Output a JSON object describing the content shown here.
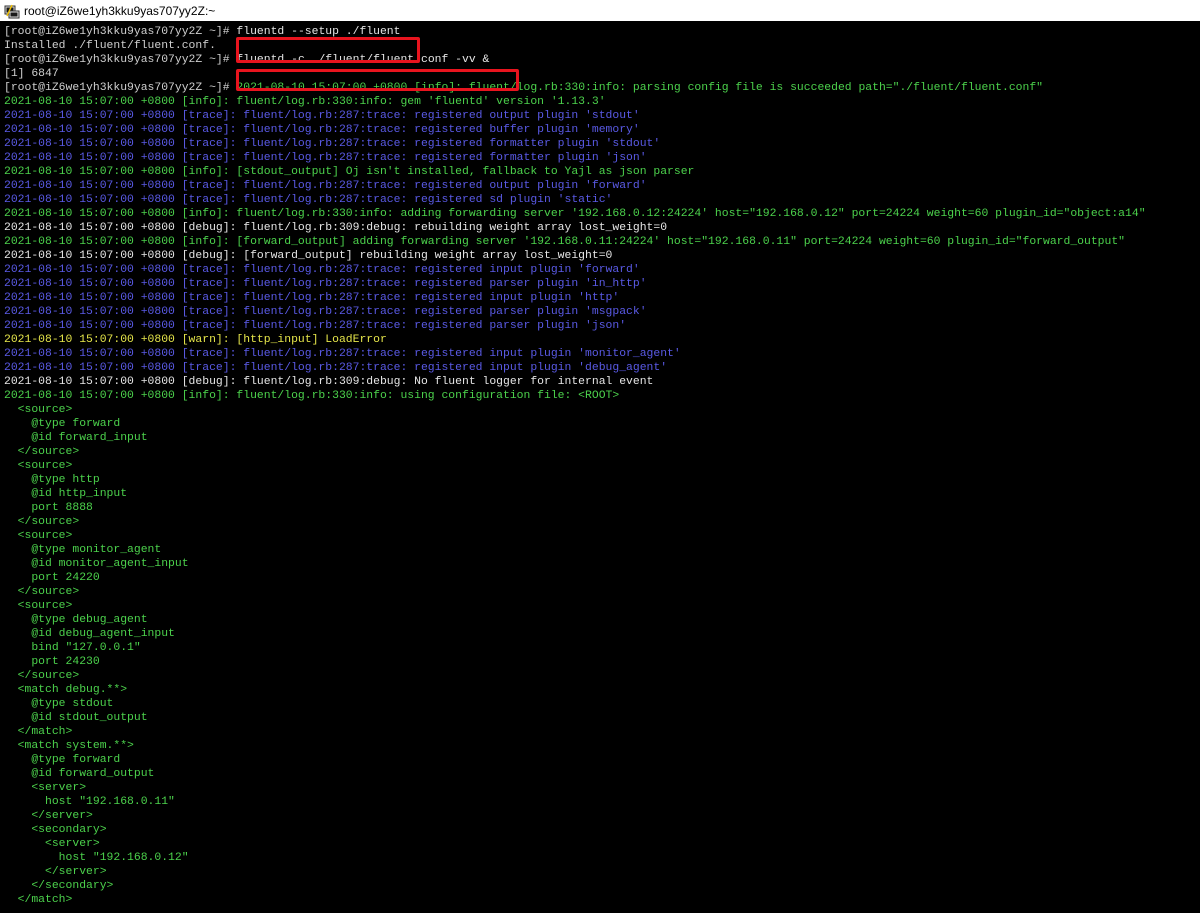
{
  "window": {
    "title": "root@iZ6we1yh3kku9yas707yy2Z:~",
    "icon": "putty-terminal-icon"
  },
  "colors": {
    "info": "#4cd24c",
    "trace": "#5a5ae6",
    "debug": "#e6e6e6",
    "warn": "#e6e64a",
    "plain": "#d0d0d0",
    "highlight_box": "#e8141e"
  },
  "terminal": {
    "lines": [
      {
        "segments": [
          {
            "t": "[root@iZ6we1yh3kku9yas707yy2Z ~]# ",
            "c": "plain"
          },
          {
            "t": "fluentd --setup ./fluent",
            "c": "cmd"
          }
        ],
        "highlight": true
      },
      {
        "segments": [
          {
            "t": "Installed ./fluent/fluent.conf.",
            "c": "plain"
          }
        ]
      },
      {
        "segments": [
          {
            "t": "[root@iZ6we1yh3kku9yas707yy2Z ~]# ",
            "c": "plain"
          },
          {
            "t": "fluentd -c ./fluent/fluent.conf -vv &",
            "c": "cmd"
          }
        ],
        "highlight": true
      },
      {
        "segments": [
          {
            "t": "[1] 6847",
            "c": "plain"
          }
        ]
      },
      {
        "segments": [
          {
            "t": "[root@iZ6we1yh3kku9yas707yy2Z ~]# ",
            "c": "plain"
          },
          {
            "t": "2021-08-10 15:07:00 +0800 [info]: fluent/log.rb:330:info: parsing config file is succeeded path=\"./fluent/fluent.conf\"",
            "c": "green"
          }
        ]
      },
      {
        "segments": [
          {
            "t": "2021-08-10 15:07:00 +0800 [info]: fluent/log.rb:330:info: gem 'fluentd' version '1.13.3'",
            "c": "green"
          }
        ]
      },
      {
        "segments": [
          {
            "t": "2021-08-10 15:07:00 +0800 [trace]: fluent/log.rb:287:trace: registered output plugin 'stdout'",
            "c": "blue"
          }
        ]
      },
      {
        "segments": [
          {
            "t": "2021-08-10 15:07:00 +0800 [trace]: fluent/log.rb:287:trace: registered buffer plugin 'memory'",
            "c": "blue"
          }
        ]
      },
      {
        "segments": [
          {
            "t": "2021-08-10 15:07:00 +0800 [trace]: fluent/log.rb:287:trace: registered formatter plugin 'stdout'",
            "c": "blue"
          }
        ]
      },
      {
        "segments": [
          {
            "t": "2021-08-10 15:07:00 +0800 [trace]: fluent/log.rb:287:trace: registered formatter plugin 'json'",
            "c": "blue"
          }
        ]
      },
      {
        "segments": [
          {
            "t": "2021-08-10 15:07:00 +0800 [info]: [stdout_output] Oj isn't installed, fallback to Yajl as json parser",
            "c": "green"
          }
        ]
      },
      {
        "segments": [
          {
            "t": "2021-08-10 15:07:00 +0800 [trace]: fluent/log.rb:287:trace: registered output plugin 'forward'",
            "c": "blue"
          }
        ]
      },
      {
        "segments": [
          {
            "t": "2021-08-10 15:07:00 +0800 [trace]: fluent/log.rb:287:trace: registered sd plugin 'static'",
            "c": "blue"
          }
        ]
      },
      {
        "segments": [
          {
            "t": "2021-08-10 15:07:00 +0800 [info]: fluent/log.rb:330:info: adding forwarding server '192.168.0.12:24224' host=\"192.168.0.12\" port=24224 weight=60 plugin_id=\"object:a14\"",
            "c": "green"
          }
        ]
      },
      {
        "segments": [
          {
            "t": "2021-08-10 15:07:00 +0800 [debug]: fluent/log.rb:309:debug: rebuilding weight array lost_weight=0",
            "c": "white"
          }
        ]
      },
      {
        "segments": [
          {
            "t": "2021-08-10 15:07:00 +0800 [info]: [forward_output] adding forwarding server '192.168.0.11:24224' host=\"192.168.0.11\" port=24224 weight=60 plugin_id=\"forward_output\"",
            "c": "green"
          }
        ]
      },
      {
        "segments": [
          {
            "t": "2021-08-10 15:07:00 +0800 [debug]: [forward_output] rebuilding weight array lost_weight=0",
            "c": "white"
          }
        ]
      },
      {
        "segments": [
          {
            "t": "2021-08-10 15:07:00 +0800 [trace]: fluent/log.rb:287:trace: registered input plugin 'forward'",
            "c": "blue"
          }
        ]
      },
      {
        "segments": [
          {
            "t": "2021-08-10 15:07:00 +0800 [trace]: fluent/log.rb:287:trace: registered parser plugin 'in_http'",
            "c": "blue"
          }
        ]
      },
      {
        "segments": [
          {
            "t": "2021-08-10 15:07:00 +0800 [trace]: fluent/log.rb:287:trace: registered input plugin 'http'",
            "c": "blue"
          }
        ]
      },
      {
        "segments": [
          {
            "t": "2021-08-10 15:07:00 +0800 [trace]: fluent/log.rb:287:trace: registered parser plugin 'msgpack'",
            "c": "blue"
          }
        ]
      },
      {
        "segments": [
          {
            "t": "2021-08-10 15:07:00 +0800 [trace]: fluent/log.rb:287:trace: registered parser plugin 'json'",
            "c": "blue"
          }
        ]
      },
      {
        "segments": [
          {
            "t": "2021-08-10 15:07:00 +0800 [warn]: [http_input] LoadError",
            "c": "yellow"
          }
        ]
      },
      {
        "segments": [
          {
            "t": "2021-08-10 15:07:00 +0800 [trace]: fluent/log.rb:287:trace: registered input plugin 'monitor_agent'",
            "c": "blue"
          }
        ]
      },
      {
        "segments": [
          {
            "t": "2021-08-10 15:07:00 +0800 [trace]: fluent/log.rb:287:trace: registered input plugin 'debug_agent'",
            "c": "blue"
          }
        ]
      },
      {
        "segments": [
          {
            "t": "2021-08-10 15:07:00 +0800 [debug]: fluent/log.rb:309:debug: No fluent logger for internal event",
            "c": "white"
          }
        ]
      },
      {
        "segments": [
          {
            "t": "2021-08-10 15:07:00 +0800 [info]: fluent/log.rb:330:info: using configuration file: <ROOT>",
            "c": "green"
          }
        ]
      },
      {
        "segments": [
          {
            "t": "  <source>",
            "c": "green"
          }
        ]
      },
      {
        "segments": [
          {
            "t": "    @type forward",
            "c": "green"
          }
        ]
      },
      {
        "segments": [
          {
            "t": "    @id forward_input",
            "c": "green"
          }
        ]
      },
      {
        "segments": [
          {
            "t": "  </source>",
            "c": "green"
          }
        ]
      },
      {
        "segments": [
          {
            "t": "  <source>",
            "c": "green"
          }
        ]
      },
      {
        "segments": [
          {
            "t": "    @type http",
            "c": "green"
          }
        ]
      },
      {
        "segments": [
          {
            "t": "    @id http_input",
            "c": "green"
          }
        ]
      },
      {
        "segments": [
          {
            "t": "    port 8888",
            "c": "green"
          }
        ]
      },
      {
        "segments": [
          {
            "t": "  </source>",
            "c": "green"
          }
        ]
      },
      {
        "segments": [
          {
            "t": "  <source>",
            "c": "green"
          }
        ]
      },
      {
        "segments": [
          {
            "t": "    @type monitor_agent",
            "c": "green"
          }
        ]
      },
      {
        "segments": [
          {
            "t": "    @id monitor_agent_input",
            "c": "green"
          }
        ]
      },
      {
        "segments": [
          {
            "t": "    port 24220",
            "c": "green"
          }
        ]
      },
      {
        "segments": [
          {
            "t": "  </source>",
            "c": "green"
          }
        ]
      },
      {
        "segments": [
          {
            "t": "  <source>",
            "c": "green"
          }
        ]
      },
      {
        "segments": [
          {
            "t": "    @type debug_agent",
            "c": "green"
          }
        ]
      },
      {
        "segments": [
          {
            "t": "    @id debug_agent_input",
            "c": "green"
          }
        ]
      },
      {
        "segments": [
          {
            "t": "    bind \"127.0.0.1\"",
            "c": "green"
          }
        ]
      },
      {
        "segments": [
          {
            "t": "    port 24230",
            "c": "green"
          }
        ]
      },
      {
        "segments": [
          {
            "t": "  </source>",
            "c": "green"
          }
        ]
      },
      {
        "segments": [
          {
            "t": "  <match debug.**>",
            "c": "green"
          }
        ]
      },
      {
        "segments": [
          {
            "t": "    @type stdout",
            "c": "green"
          }
        ]
      },
      {
        "segments": [
          {
            "t": "    @id stdout_output",
            "c": "green"
          }
        ]
      },
      {
        "segments": [
          {
            "t": "  </match>",
            "c": "green"
          }
        ]
      },
      {
        "segments": [
          {
            "t": "  <match system.**>",
            "c": "green"
          }
        ]
      },
      {
        "segments": [
          {
            "t": "    @type forward",
            "c": "green"
          }
        ]
      },
      {
        "segments": [
          {
            "t": "    @id forward_output",
            "c": "green"
          }
        ]
      },
      {
        "segments": [
          {
            "t": "    <server>",
            "c": "green"
          }
        ]
      },
      {
        "segments": [
          {
            "t": "      host \"192.168.0.11\"",
            "c": "green"
          }
        ]
      },
      {
        "segments": [
          {
            "t": "    </server>",
            "c": "green"
          }
        ]
      },
      {
        "segments": [
          {
            "t": "    <secondary>",
            "c": "green"
          }
        ]
      },
      {
        "segments": [
          {
            "t": "      <server>",
            "c": "green"
          }
        ]
      },
      {
        "segments": [
          {
            "t": "        host \"192.168.0.12\"",
            "c": "green"
          }
        ]
      },
      {
        "segments": [
          {
            "t": "      </server>",
            "c": "green"
          }
        ]
      },
      {
        "segments": [
          {
            "t": "    </secondary>",
            "c": "green"
          }
        ]
      },
      {
        "segments": [
          {
            "t": "  </match>",
            "c": "green"
          }
        ]
      }
    ]
  }
}
